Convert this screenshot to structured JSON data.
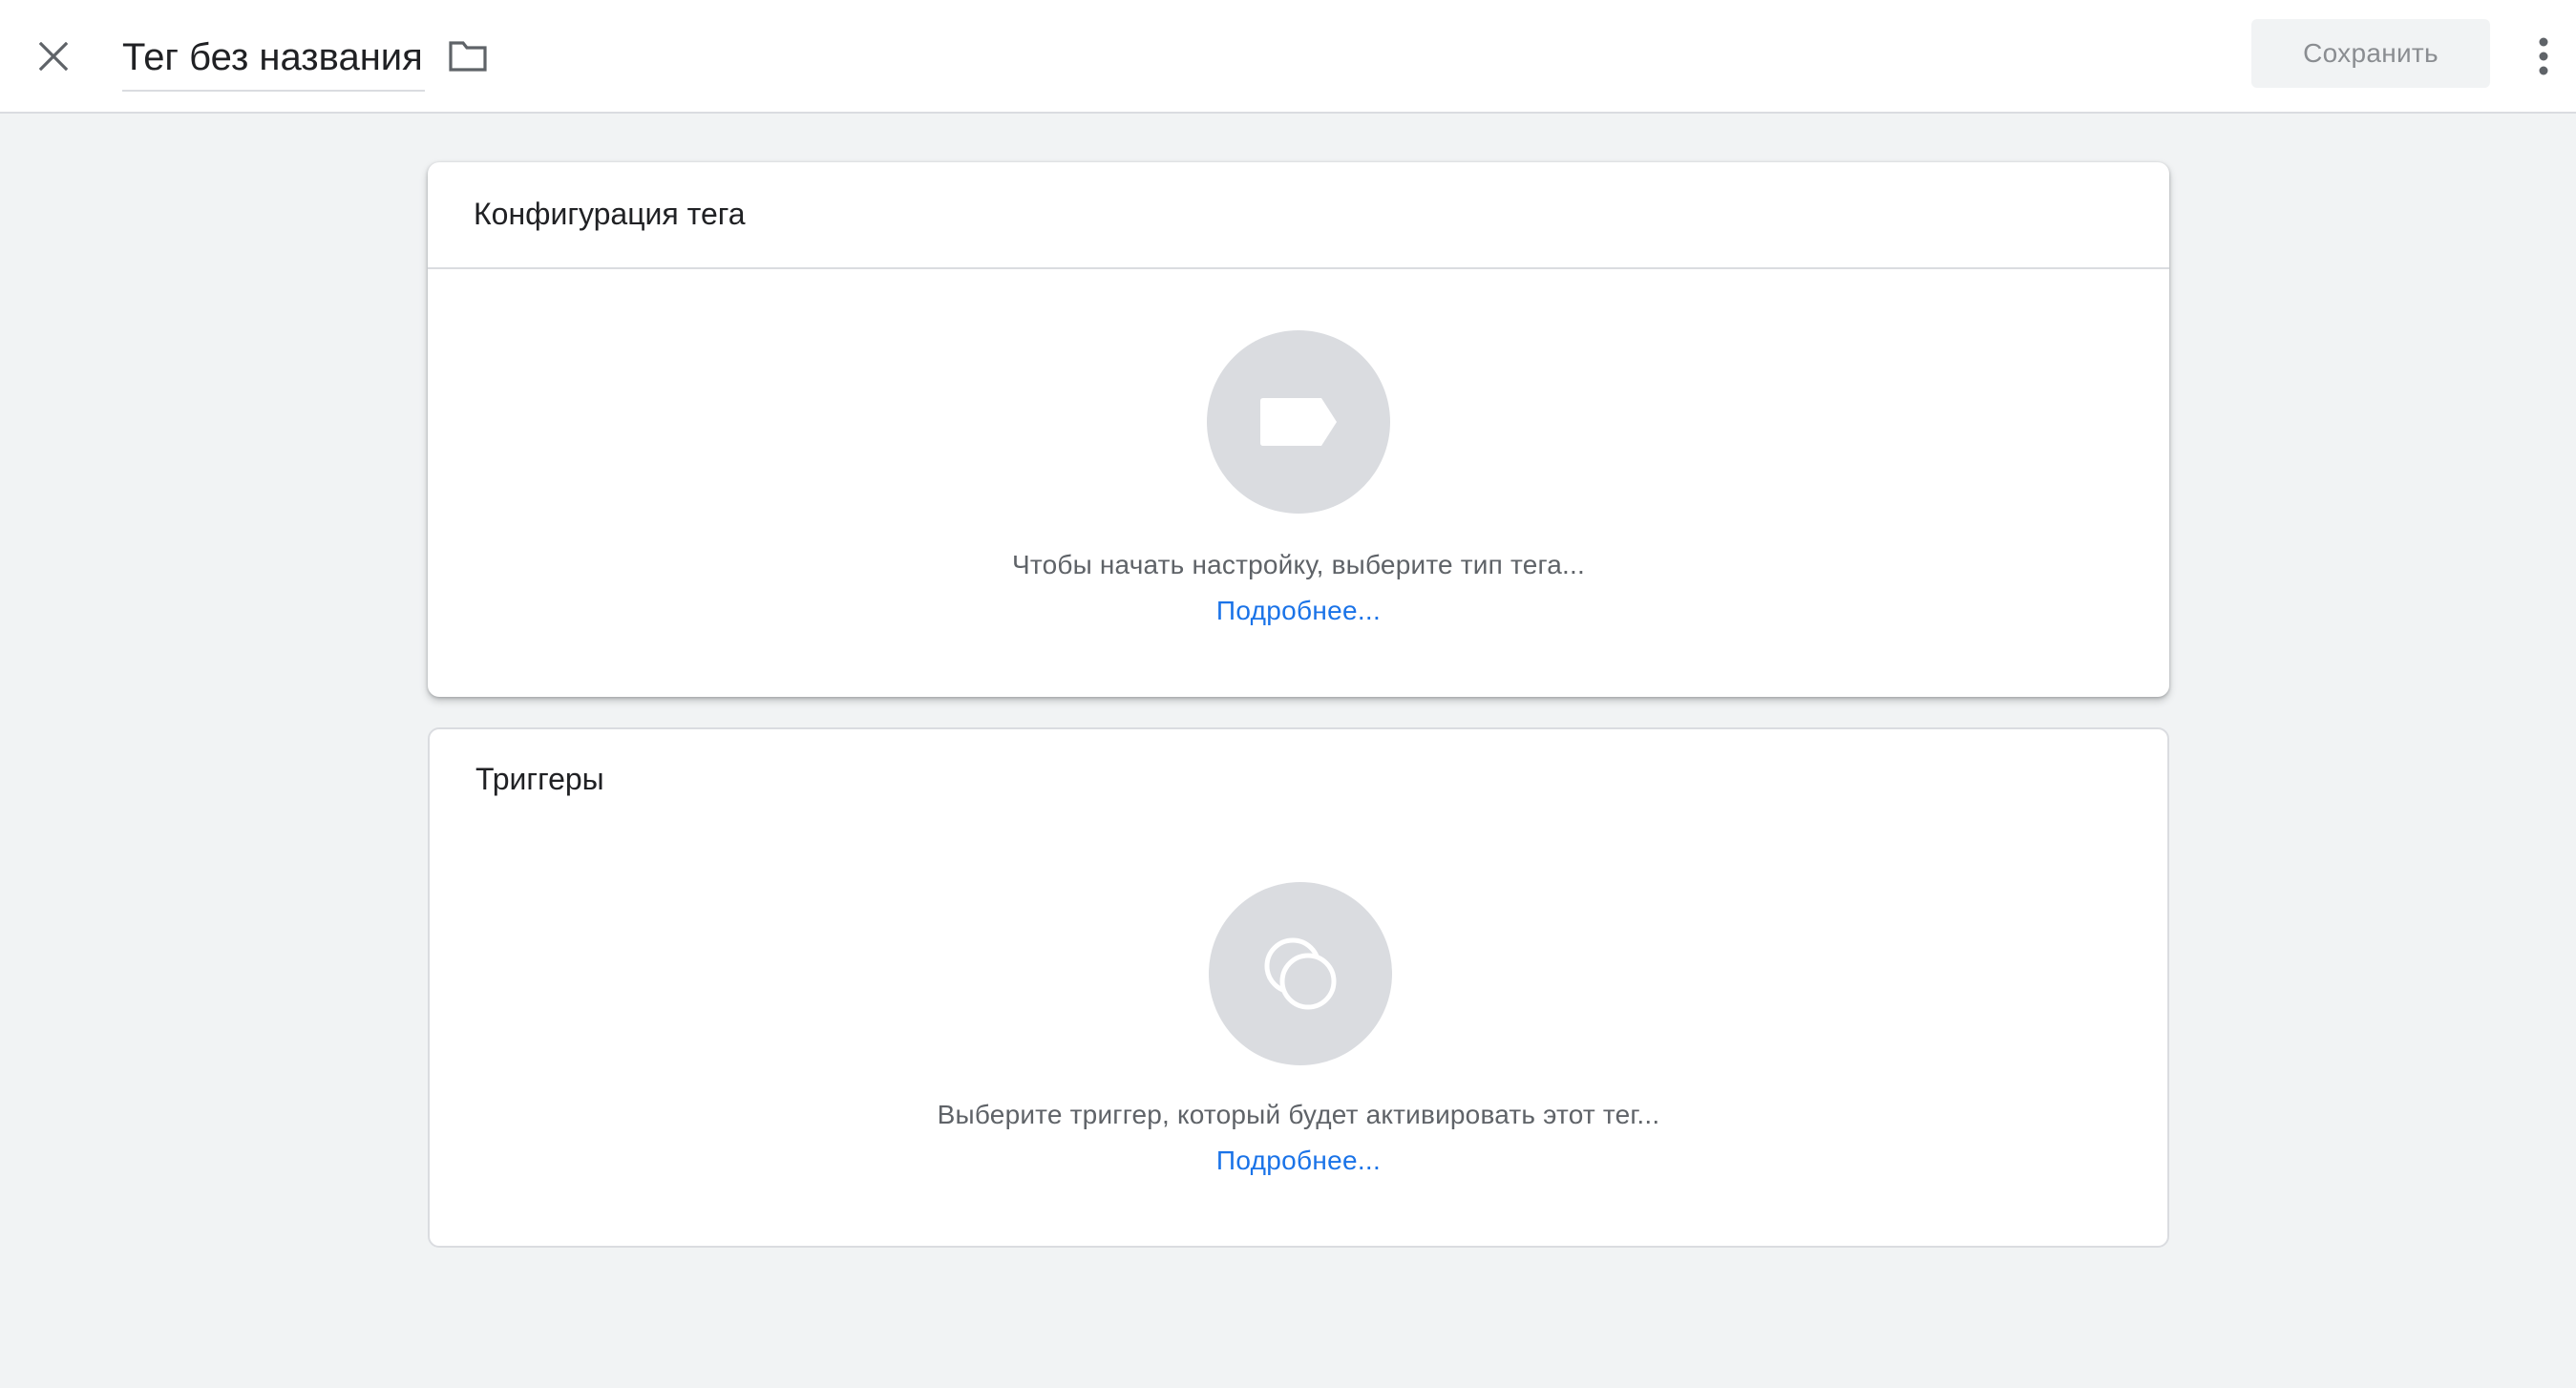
{
  "header": {
    "title": "Тег без названия",
    "save_label": "Сохранить"
  },
  "config_card": {
    "title": "Конфигурация тега",
    "hint": "Чтобы начать настройку, выберите тип тега...",
    "link": "Подробнее..."
  },
  "triggers_card": {
    "title": "Триггеры",
    "hint": "Выберите триггер, который будет активировать этот тег...",
    "link": "Подробнее..."
  },
  "icons": {
    "close": "close-icon",
    "folder": "folder-icon",
    "more": "more-vert-icon",
    "tag": "tag-icon",
    "trigger": "trigger-icon"
  },
  "colors": {
    "background": "#f1f3f4",
    "link": "#1a73e8",
    "icon_circle": "#dadce0"
  }
}
